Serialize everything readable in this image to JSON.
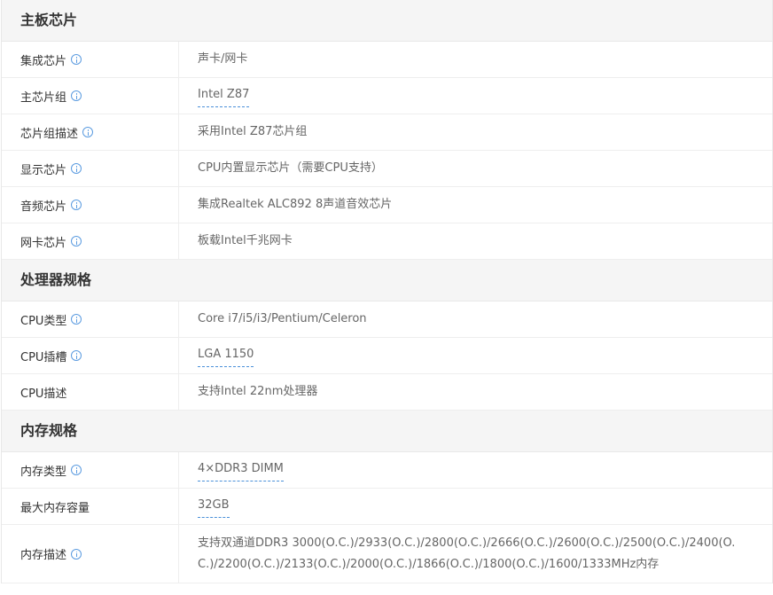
{
  "sections": [
    {
      "title": "主板芯片",
      "rows": [
        {
          "label": "集成芯片",
          "value": "声卡/网卡"
        },
        {
          "label": "主芯片组",
          "value": "Intel Z87"
        },
        {
          "label": "芯片组描述",
          "value": "采用Intel Z87芯片组"
        },
        {
          "label": "显示芯片",
          "value": "CPU内置显示芯片（需要CPU支持）"
        },
        {
          "label": "音频芯片",
          "value": "集成Realtek ALC892 8声道音效芯片"
        },
        {
          "label": "网卡芯片",
          "value": "板载Intel千兆网卡"
        }
      ]
    },
    {
      "title": "处理器规格",
      "rows": [
        {
          "label": "CPU类型",
          "value": "Core i7/i5/i3/Pentium/Celeron"
        },
        {
          "label": "CPU插槽",
          "value": "LGA 1150"
        },
        {
          "label": "CPU描述",
          "value": "支持Intel 22nm处理器"
        }
      ]
    },
    {
      "title": "内存规格",
      "rows": [
        {
          "label": "内存类型",
          "value": "4×DDR3 DIMM"
        },
        {
          "label": "最大内存容量",
          "value": "32GB"
        },
        {
          "label": "内存描述",
          "value": "支持双通道DDR3 3000(O.C.)/2933(O.C.)/2800(O.C.)/2666(O.C.)/2600(O.C.)/2500(O.C.)/2400(O.C.)/2200(O.C.)/2133(O.C.)/2000(O.C.)/1866(O.C.)/1800(O.C.)/1600/1333MHz内存"
        }
      ]
    }
  ],
  "colors": {
    "info_icon": "#5b9be0",
    "link_underline": "#4a90d9",
    "section_bg": "#f5f5f5"
  },
  "icons": {
    "info": "info-circle-icon"
  }
}
